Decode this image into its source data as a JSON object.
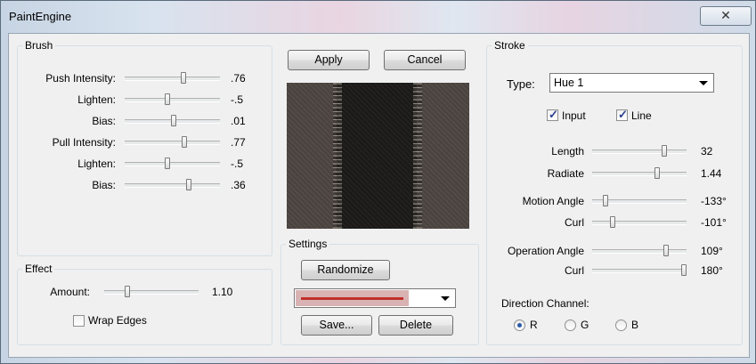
{
  "window": {
    "title": "PaintEngine",
    "close_glyph": "✕"
  },
  "brush": {
    "title": "Brush",
    "sliders": [
      {
        "label": "Push Intensity:",
        "value": ".76",
        "level": 0.62
      },
      {
        "label": "Lighten:",
        "value": "-.5",
        "level": 0.45
      },
      {
        "label": "Bias:",
        "value": ".01",
        "level": 0.51
      },
      {
        "label": "Pull Intensity:",
        "value": ".77",
        "level": 0.63
      },
      {
        "label": "Lighten:",
        "value": "-.5",
        "level": 0.45
      },
      {
        "label": "Bias:",
        "value": ".36",
        "level": 0.68
      }
    ]
  },
  "effect": {
    "title": "Effect",
    "amount_label": "Amount:",
    "amount_value": "1.10",
    "amount_level": 0.23,
    "wrap_edges_label": "Wrap Edges",
    "wrap_edges_checked": false
  },
  "actions": {
    "apply": "Apply",
    "cancel": "Cancel"
  },
  "settings": {
    "title": "Settings",
    "randomize": "Randomize",
    "save": "Save...",
    "delete": "Delete",
    "preset_color": "#c0302a"
  },
  "stroke": {
    "title": "Stroke",
    "type_label": "Type:",
    "type_value": "Hue 1",
    "input_label": "Input",
    "input_checked": true,
    "line_label": "Line",
    "line_checked": true,
    "sliders": [
      {
        "label": "Length",
        "value": "32",
        "level": 0.78
      },
      {
        "label": "Radiate",
        "value": "1.44",
        "level": 0.7
      },
      {
        "label": "Motion Angle",
        "value": "-133°",
        "level": 0.12
      },
      {
        "label": "Curl",
        "value": "-101°",
        "level": 0.2
      },
      {
        "label": "Operation Angle",
        "value": "109°",
        "level": 0.8
      },
      {
        "label": "Curl",
        "value": "180°",
        "level": 1.0
      }
    ],
    "direction_label": "Direction Channel:",
    "channels": [
      {
        "label": "R",
        "selected": true
      },
      {
        "label": "G",
        "selected": false
      },
      {
        "label": "B",
        "selected": false
      }
    ]
  }
}
